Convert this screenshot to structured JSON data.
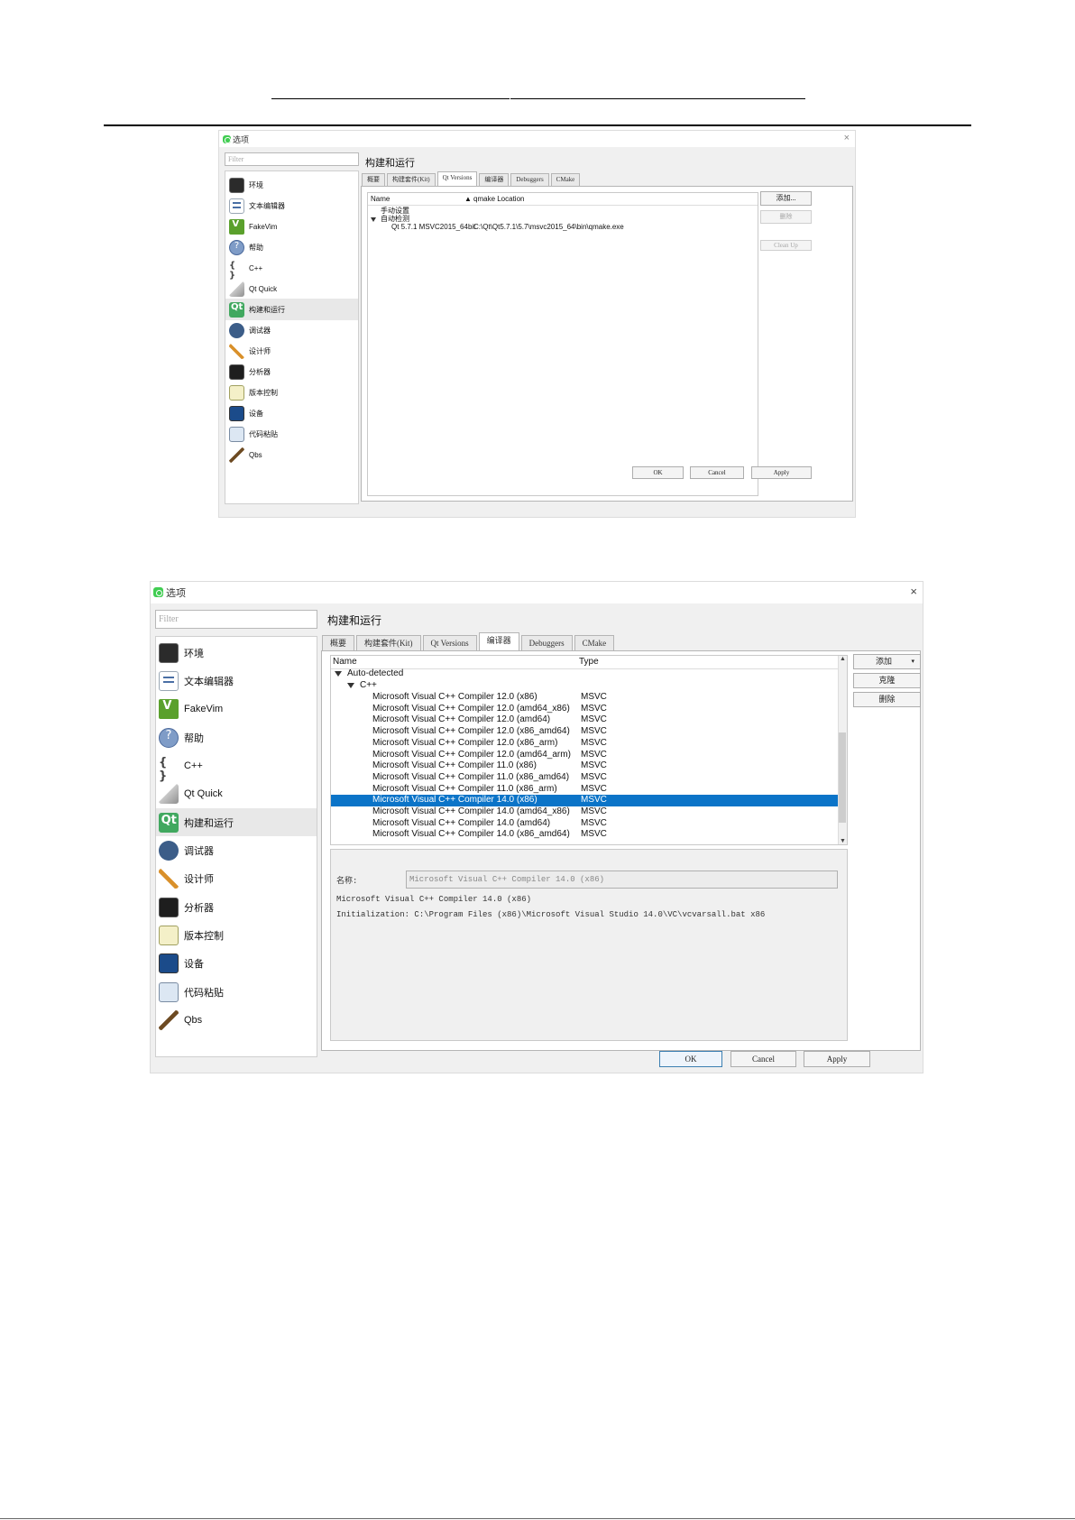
{
  "dialog1": {
    "title": "选项",
    "close": "×",
    "filter_placeholder": "Filter",
    "sidebar": [
      "环境",
      "文本编辑器",
      "FakeVim",
      "帮助",
      "C++",
      "Qt Quick",
      "构建和运行",
      "调试器",
      "设计师",
      "分析器",
      "版本控制",
      "设备",
      "代码粘贴",
      "Qbs"
    ],
    "page_title": "构建和运行",
    "tabs": [
      "概要",
      "构建套件(Kit)",
      "Qt Versions",
      "编译器",
      "Debuggers",
      "CMake"
    ],
    "columns": {
      "name": "Name",
      "location": "qmake Location"
    },
    "tree": {
      "manual": "手动设置",
      "auto": "自动检测",
      "version_name": "Qt 5.7.1 MSVC2015_64bit",
      "version_path": "C:\\Qt\\Qt5.7.1\\5.7\\msvc2015_64\\bin\\qmake.exe"
    },
    "side_buttons": {
      "add": "添加...",
      "remove": "删除",
      "cleanup": "Clean Up"
    },
    "bottom_buttons": {
      "ok": "OK",
      "cancel": "Cancel",
      "apply": "Apply"
    }
  },
  "dialog2": {
    "title": "选项",
    "close": "×",
    "filter_placeholder": "Filter",
    "sidebar": [
      "环境",
      "文本编辑器",
      "FakeVim",
      "帮助",
      "C++",
      "Qt Quick",
      "构建和运行",
      "调试器",
      "设计师",
      "分析器",
      "版本控制",
      "设备",
      "代码粘贴",
      "Qbs"
    ],
    "page_title": "构建和运行",
    "tabs": [
      "概要",
      "构建套件(Kit)",
      "Qt Versions",
      "编译器",
      "Debuggers",
      "CMake"
    ],
    "columns": {
      "name": "Name",
      "type": "Type"
    },
    "tree": {
      "auto": "Auto-detected",
      "group": "C++",
      "compilers": [
        {
          "name": "Microsoft Visual C++ Compiler 12.0 (x86)",
          "type": "MSVC"
        },
        {
          "name": "Microsoft Visual C++ Compiler 12.0 (amd64_x86)",
          "type": "MSVC"
        },
        {
          "name": "Microsoft Visual C++ Compiler 12.0 (amd64)",
          "type": "MSVC"
        },
        {
          "name": "Microsoft Visual C++ Compiler 12.0 (x86_amd64)",
          "type": "MSVC"
        },
        {
          "name": "Microsoft Visual C++ Compiler 12.0 (x86_arm)",
          "type": "MSVC"
        },
        {
          "name": "Microsoft Visual C++ Compiler 12.0 (amd64_arm)",
          "type": "MSVC"
        },
        {
          "name": "Microsoft Visual C++ Compiler 11.0 (x86)",
          "type": "MSVC"
        },
        {
          "name": "Microsoft Visual C++ Compiler 11.0 (x86_amd64)",
          "type": "MSVC"
        },
        {
          "name": "Microsoft Visual C++ Compiler 11.0 (x86_arm)",
          "type": "MSVC"
        },
        {
          "name": "Microsoft Visual C++ Compiler 14.0 (x86)",
          "type": "MSVC"
        },
        {
          "name": "Microsoft Visual C++ Compiler 14.0 (amd64_x86)",
          "type": "MSVC"
        },
        {
          "name": "Microsoft Visual C++ Compiler 14.0 (amd64)",
          "type": "MSVC"
        },
        {
          "name": "Microsoft Visual C++ Compiler 14.0 (x86_amd64)",
          "type": "MSVC"
        }
      ]
    },
    "details": {
      "name_label": "名称:",
      "name_value": "Microsoft Visual C++ Compiler 14.0 (x86)",
      "line1": "Microsoft Visual C++ Compiler 14.0 (x86)",
      "line2": "Initialization: C:\\Program Files (x86)\\Microsoft Visual Studio 14.0\\VC\\vcvarsall.bat x86"
    },
    "side_buttons": {
      "add": "添加",
      "clone": "克隆",
      "remove": "删除"
    },
    "bottom_buttons": {
      "ok": "OK",
      "cancel": "Cancel",
      "apply": "Apply"
    }
  }
}
